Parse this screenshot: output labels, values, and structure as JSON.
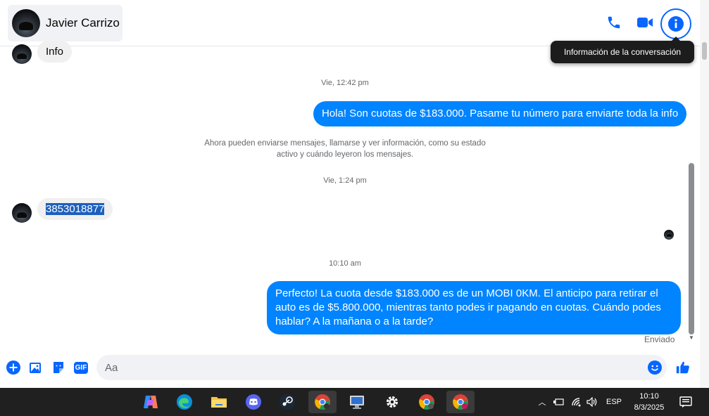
{
  "header": {
    "contact_name": "Javier Carrizo",
    "tooltip": "Información de la conversación"
  },
  "messages": {
    "info_label": "Info",
    "ts1": "Vie, 12:42 pm",
    "out1": "Hola! Son cuotas de $183.000. Pasame tu número para enviarte toda la info",
    "system_line1": "Ahora pueden enviarse mensajes, llamarse y ver información, como su estado",
    "system_line2": "activo y cuándo leyeron los mensajes.",
    "ts2": "Vie, 1:24 pm",
    "in_phone": "3853018877",
    "ts3": "10:10 am",
    "out2_line1": "Perfecto! La cuota desde $183.000 es de un MOBI 0KM. El anticipo para retirar el",
    "out2_line2": "auto es de $5.800.000, mientras tanto podes ir pagando en cuotas. Cuándo podes",
    "out2_line3": "hablar? A la mañana o a la tarde?",
    "status": "Enviado"
  },
  "composer": {
    "placeholder": "Aa",
    "gif_label": "GIF"
  },
  "taskbar": {
    "language": "ESP",
    "time": "10:10",
    "date": "8/3/2025"
  },
  "colors": {
    "accent": "#0866ff",
    "outgoing_bubble": "#0084ff",
    "incoming_bubble": "#f0f0f0",
    "taskbar": "#202020"
  }
}
